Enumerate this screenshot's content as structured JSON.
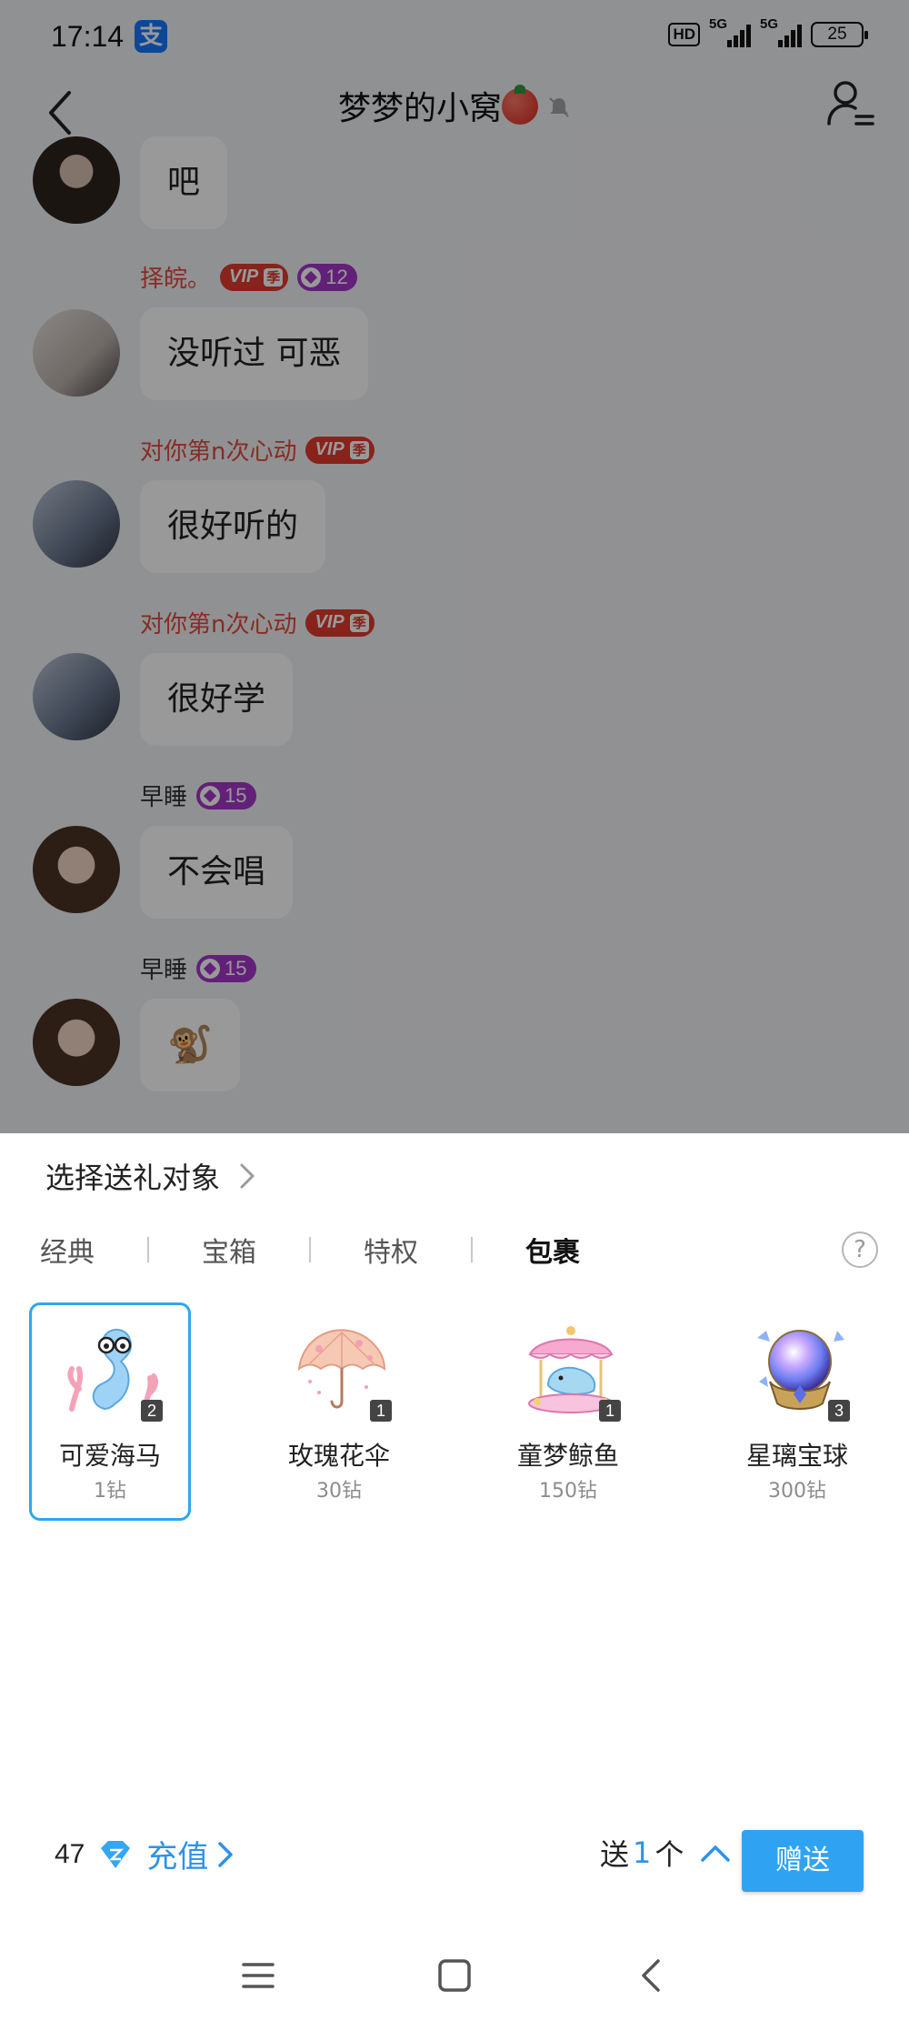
{
  "status_bar": {
    "time": "17:14",
    "app_icon": "支",
    "network_hd": "HD",
    "signal1": "5G",
    "signal2": "5G",
    "battery": "25"
  },
  "header": {
    "title": "梦梦的小窝",
    "icons": [
      "back-arrow-icon",
      "tomato-emoji-icon",
      "mute-bell-icon",
      "group-member-icon"
    ]
  },
  "chat": {
    "messages": [
      {
        "user": "",
        "text": "吧"
      },
      {
        "user": "择皖。",
        "vip": "VIP",
        "vip_tag": "季",
        "level": "12",
        "text": "没听过 可恶"
      },
      {
        "user": "对你第n次心动",
        "vip": "VIP",
        "vip_tag": "季",
        "text": "很好听的"
      },
      {
        "user": "对你第n次心动",
        "vip": "VIP",
        "vip_tag": "季",
        "text": "很好学"
      },
      {
        "user": "早睡",
        "level": "15",
        "text": "不会唱"
      },
      {
        "user": "早睡",
        "level": "15",
        "text": "🐒"
      }
    ]
  },
  "gift_panel": {
    "select_target": "选择送礼对象",
    "tabs": [
      "经典",
      "宝箱",
      "特权",
      "包裹"
    ],
    "active_tab": "包裹",
    "help": "?",
    "gifts": [
      {
        "name": "可爱海马",
        "price": "1钻",
        "count": "2",
        "icon": "seahorse-gift-icon"
      },
      {
        "name": "玫瑰花伞",
        "price": "30钻",
        "count": "1",
        "icon": "rose-umbrella-gift-icon"
      },
      {
        "name": "童梦鲸鱼",
        "price": "150钻",
        "count": "1",
        "icon": "carousel-whale-gift-icon"
      },
      {
        "name": "星璃宝球",
        "price": "300钻",
        "count": "3",
        "icon": "crystal-orb-gift-icon"
      }
    ],
    "balance": "47",
    "recharge": "充值",
    "send_prefix": "送",
    "send_qty": "1",
    "send_suffix": "个",
    "send_button": "赠送"
  },
  "colors": {
    "accent": "#2fa3f2",
    "vip_red": "#e23b2e",
    "level_purple": "#a436c9",
    "username_red": "#e24a3b"
  },
  "system_nav": {
    "icons": [
      "menu-icon",
      "home-icon",
      "back-icon"
    ]
  }
}
